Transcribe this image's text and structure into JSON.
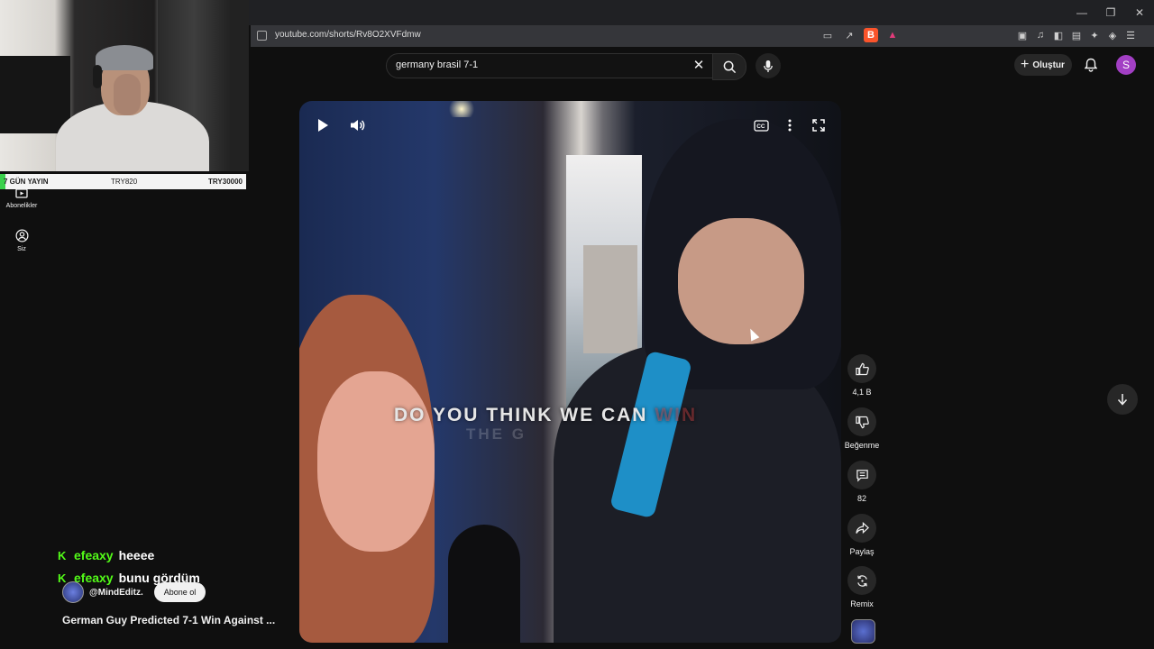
{
  "browser": {
    "url": "youtube.com/shorts/Rv8O2XVFdmw",
    "window_controls": [
      "—",
      "❐",
      "✕"
    ]
  },
  "search": {
    "query": "germany brasil 7-1"
  },
  "header": {
    "create_label": "Oluştur",
    "avatar_letter": "S",
    "avatar_color": "#a23fc4"
  },
  "sidebar": {
    "items": [
      {
        "label": "Abonelikler",
        "icon": "subscriptions-icon"
      },
      {
        "label": "Siz",
        "icon": "you-icon"
      }
    ]
  },
  "stream_ticker": {
    "left": "7 GÜN YAYIN",
    "middle": "TRY820",
    "right": "TRY30000"
  },
  "video": {
    "subtitle": "DO YOU THINK WE CAN",
    "subtitle_faded": "WIN",
    "subtitle_ghost": "THE G"
  },
  "actions": {
    "like_count": "4,1 B",
    "dislike_label": "Beğenme",
    "comment_count": "82",
    "share_label": "Paylaş",
    "remix_label": "Remix"
  },
  "chat": [
    {
      "user": "efeaxy",
      "message": "heeee"
    },
    {
      "user": "efeaxy",
      "message": "bunu gördüm"
    }
  ],
  "channel": {
    "name": "@MindEditz.",
    "subscribe_label": "Abone ol"
  },
  "title": "German Guy Predicted 7-1 Win Against ..."
}
